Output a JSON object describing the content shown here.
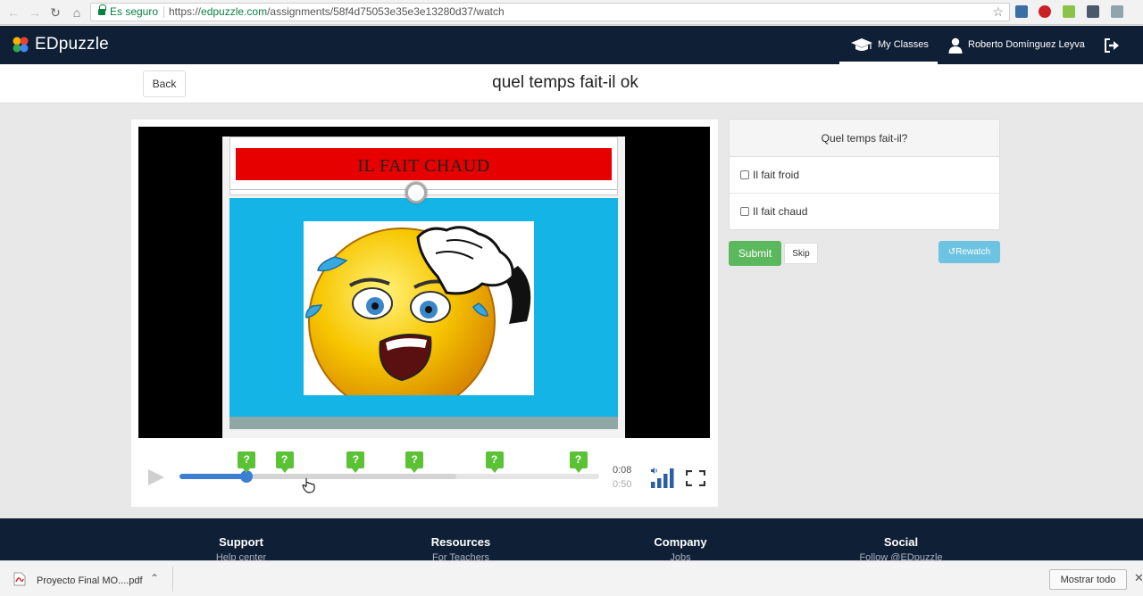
{
  "browser": {
    "secure_label": "Es seguro",
    "url_scheme": "https://",
    "url_host": "edpuzzle.com",
    "url_path": "/assignments/58f4d75053e35e3e13280d37/watch",
    "icons": [
      "back-arrow-icon",
      "forward-arrow-icon",
      "reload-icon",
      "home-icon",
      "lock-icon",
      "star-icon"
    ]
  },
  "header": {
    "brand": "EDpuzzle",
    "my_classes": "My Classes",
    "user_name": "Roberto Domínguez Leyva",
    "bg_color": "#0f1f35"
  },
  "assignment": {
    "back_label": "Back",
    "title": "quel temps fait-il ok"
  },
  "video": {
    "slide_caption": "IL FAIT CHAUD",
    "current_time": "0:08",
    "duration": "0:50",
    "played_fraction": 0.16,
    "buffered_fraction": 0.66,
    "question_marker_label": "?",
    "question_marker_positions": [
      0.16,
      0.25,
      0.42,
      0.56,
      0.75,
      0.95
    ]
  },
  "question": {
    "prompt": "Quel temps fait-il?",
    "options": [
      "Il fait froid",
      "Il fait chaud"
    ],
    "submit_label": "Submit",
    "skip_label": "Skip",
    "rewatch_label": "Rewatch"
  },
  "footer": {
    "columns": [
      {
        "heading": "Support",
        "link": "Help center"
      },
      {
        "heading": "Resources",
        "link": "For Teachers"
      },
      {
        "heading": "Company",
        "link": "Jobs"
      },
      {
        "heading": "Social",
        "link": "Follow @EDpuzzle"
      }
    ]
  },
  "downloads": {
    "file_name": "Proyecto Final MO....pdf",
    "show_all": "Mostrar todo"
  },
  "colors": {
    "progress": "#3c7fd1",
    "marker": "#5bc236",
    "submit": "#5cb85c",
    "rewatch": "#6cc4e2"
  }
}
